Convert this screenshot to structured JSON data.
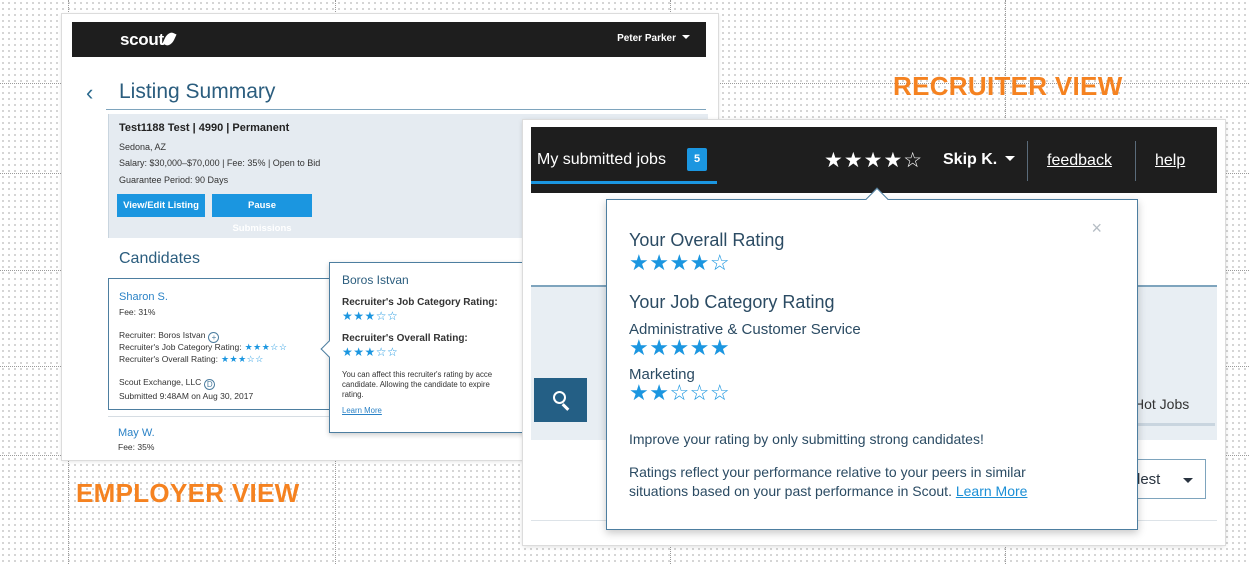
{
  "employer": {
    "brand": "scout",
    "user_name": "Peter Parker",
    "back_glyph": "‹",
    "page_title": "Listing Summary",
    "job": {
      "title": "Test1188 Test | 4990 | Permanent",
      "location": "Sedona, AZ",
      "salary": "Salary: $30,000–$70,000 | Fee: 35% | Open to Bid",
      "guarantee": "Guarantee Period: 90 Days",
      "edit_button": "View/Edit Listing",
      "pause_button": "Pause Submissions"
    },
    "candidates_heading": "Candidates",
    "candidate": {
      "name": "Sharon S.",
      "fee": "Fee: 31%",
      "recruiter": "Recruiter: Boros Istvan",
      "job_category_rating_label": "Recruiter's Job Category Rating:",
      "job_category_stars": "★★★☆☆",
      "overall_rating_label": "Recruiter's Overall Rating:",
      "overall_stars": "★★★☆☆",
      "agency": "Scout Exchange, LLC",
      "submitted": "Submitted 9:48AM on Aug 30, 2017"
    },
    "candidate2": {
      "name": "May W.",
      "fee": "Fee: 35%"
    },
    "popover": {
      "recruiter_name": "Boros Istvan",
      "job_category_label": "Recruiter's Job Category Rating:",
      "job_category_stars": "★★★☆☆",
      "overall_label": "Recruiter's Overall Rating:",
      "overall_stars": "★★★☆☆",
      "note": "You can affect this recruiter's rating by acce\ncandidate. Allowing the candidate to expire\nrating.",
      "learn_more": "Learn More"
    },
    "view_label": "EMPLOYER VIEW"
  },
  "recruiter": {
    "view_label": "RECRUITER VIEW",
    "tab_label": "My submitted jobs",
    "tab_count": "5",
    "header_stars": "★★★★☆",
    "user_name": "Skip K.",
    "feedback_link": "feedback",
    "help_link": "help",
    "hot_jobs": "Hot Jobs",
    "sort_value": "dest",
    "popover": {
      "close": "×",
      "overall_heading": "Your Overall Rating",
      "overall_stars": "★★★★☆",
      "category_heading": "Your Job Category Rating",
      "categories": [
        {
          "name": "Administrative & Customer Service",
          "stars": "★★★★★"
        },
        {
          "name": "Marketing",
          "stars": "★★☆☆☆"
        }
      ],
      "tip": "Improve your rating by only submitting strong candidates!",
      "explain": "Ratings reflect your performance relative to your peers in similar",
      "explain2": "situations based on your past performance in Scout.",
      "learn_more": "Learn More"
    }
  },
  "colors": {
    "accent": "#1b96e0",
    "label_orange": "#f58220",
    "nav_dark": "#1e1e1e"
  }
}
